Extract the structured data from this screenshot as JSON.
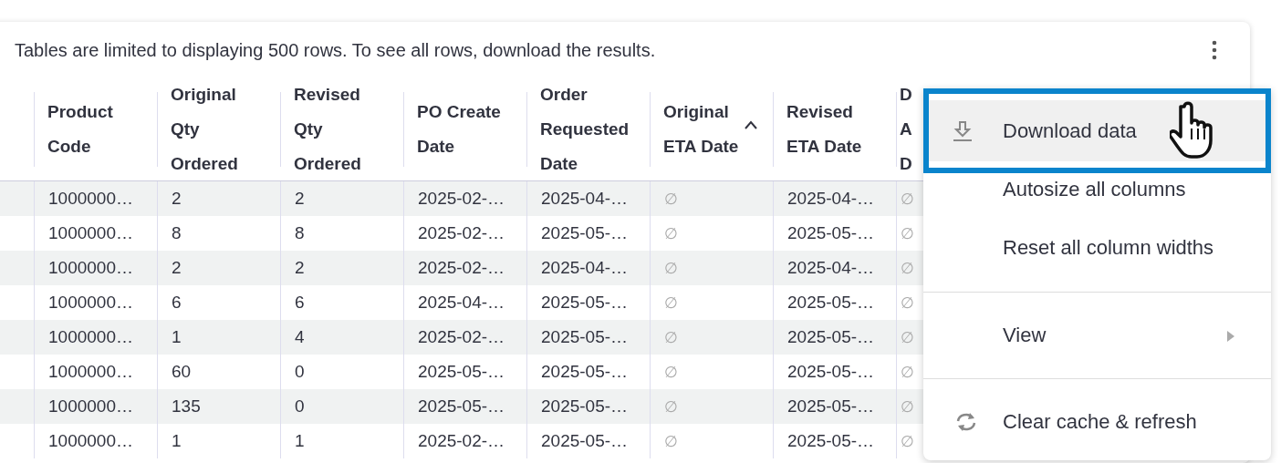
{
  "notice": "Tables are limited to displaying 500 rows. To see all rows, download the results.",
  "table": {
    "columns": [
      {
        "label": "Product Code",
        "sorted": false
      },
      {
        "label": "Original Qty Ordered",
        "sorted": false
      },
      {
        "label": "Revised Qty Ordered",
        "sorted": false
      },
      {
        "label": "PO Create Date",
        "sorted": false
      },
      {
        "label": "Order Requested Date",
        "sorted": false
      },
      {
        "label": "Original ETA Date",
        "sorted": true
      },
      {
        "label": "Revised ETA Date",
        "sorted": false
      },
      {
        "label": "D A D"
      }
    ],
    "rows": [
      [
        "1000000…",
        "2",
        "2",
        "2025-02-…",
        "2025-04-…",
        "∅",
        "2025-04-…",
        "∅"
      ],
      [
        "1000000…",
        "8",
        "8",
        "2025-02-…",
        "2025-05-…",
        "∅",
        "2025-05-…",
        "∅"
      ],
      [
        "1000000…",
        "2",
        "2",
        "2025-02-…",
        "2025-04-…",
        "∅",
        "2025-04-…",
        "∅"
      ],
      [
        "1000000…",
        "6",
        "6",
        "2025-04-…",
        "2025-05-…",
        "∅",
        "2025-05-…",
        "∅"
      ],
      [
        "1000000…",
        "1",
        "4",
        "2025-02-…",
        "2025-05-…",
        "∅",
        "2025-05-…",
        "∅"
      ],
      [
        "1000000…",
        "60",
        "0",
        "2025-05-…",
        "2025-05-…",
        "∅",
        "2025-05-…",
        "∅"
      ],
      [
        "1000000…",
        "135",
        "0",
        "2025-05-…",
        "2025-05-…",
        "∅",
        "2025-05-…",
        "∅"
      ],
      [
        "1000000…",
        "1",
        "1",
        "2025-02-…",
        "2025-05-…",
        "∅",
        "2025-05-…",
        "∅"
      ]
    ]
  },
  "menu": {
    "items": [
      {
        "kind": "download",
        "label": "Download data",
        "highlighted": true
      },
      {
        "kind": "plain",
        "label": "Autosize all columns",
        "highlighted": false
      },
      {
        "kind": "plain",
        "label": "Reset all column widths",
        "highlighted": false
      },
      {
        "kind": "divider"
      },
      {
        "kind": "submenu",
        "label": "View",
        "highlighted": false
      },
      {
        "kind": "divider"
      },
      {
        "kind": "refresh",
        "label": "Clear cache & refresh",
        "highlighted": false
      }
    ]
  }
}
